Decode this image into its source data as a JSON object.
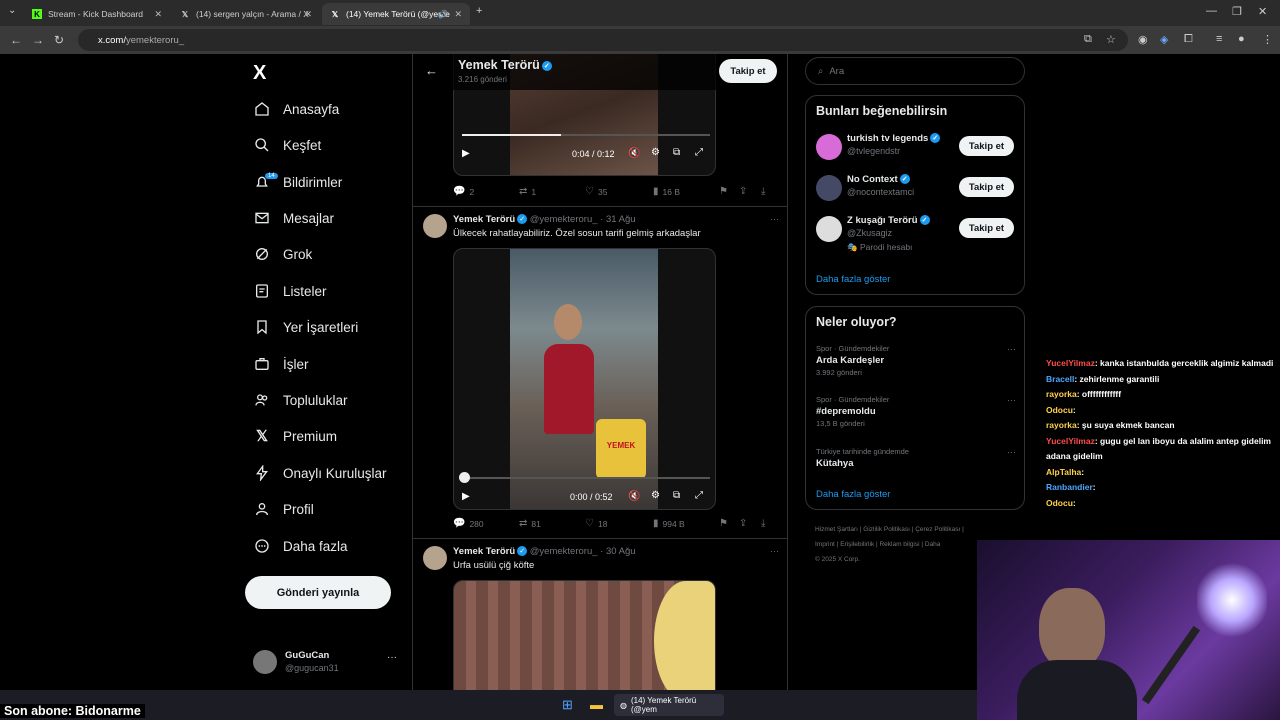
{
  "browser": {
    "tabs": [
      {
        "title": "Stream - Kick Dashboard",
        "icon": "kick-icon"
      },
      {
        "title": "(14) sergen yalçın - Arama / X",
        "icon": "x-icon"
      },
      {
        "title": "(14) Yemek Terörü (@yeme",
        "icon": "x-icon"
      }
    ],
    "url_host": "x.com/",
    "url_path": "yemekteroru_"
  },
  "nav": {
    "logo": "X",
    "badge": "14",
    "items": [
      "Anasayfa",
      "Keşfet",
      "Bildirimler",
      "Mesajlar",
      "Grok",
      "Listeler",
      "Yer İşaretleri",
      "İşler",
      "Topluluklar",
      "Premium",
      "Onaylı Kuruluşlar",
      "Profil",
      "Daha fazla"
    ],
    "post_button": "Gönderi yayınla",
    "account": {
      "name": "GuGuCan",
      "handle": "@gugucan31"
    }
  },
  "profile_header": {
    "name": "Yemek Terörü",
    "posts": "3.216 gönderi",
    "follow": "Takip et"
  },
  "tweets": [
    {
      "video_time": "0:04 / 0:12",
      "replies": "2",
      "reposts": "1",
      "likes": "35",
      "views": "16 B"
    },
    {
      "name": "Yemek Terörü",
      "handle": "@yemekteroru_",
      "date": "· 31 Ağu",
      "text": "Ülkecek rahatlayabiliriz. Özel sosun tarifi gelmiş arkadaşlar",
      "video_time": "0:00 / 0:52",
      "jar_label": "YEMEK",
      "replies": "280",
      "reposts": "81",
      "likes": "18",
      "views": "994 B"
    },
    {
      "name": "Yemek Terörü",
      "handle": "@yemekteroru_",
      "date": "· 30 Ağu",
      "text": "Urfa usülü çiğ köfte"
    }
  ],
  "right": {
    "search_placeholder": "Ara",
    "who_title": "Bunları beğenebilirsin",
    "who": [
      {
        "name": "turkish tv legends",
        "handle": "@tvlegendstr",
        "color": "#d86bd8"
      },
      {
        "name": "No Context",
        "handle": "@nocontextamci",
        "color": "#444a66"
      },
      {
        "name": "Z kuşağı Terörü",
        "handle": "@Zkusagiz",
        "sub": "Parodi hesabı",
        "color": "#dddddd"
      }
    ],
    "follow": "Takip et",
    "show_more": "Daha fazla göster",
    "trends_title": "Neler oluyor?",
    "trends": [
      {
        "cat": "Spor · Gündemdekiler",
        "title": "Arda Kardeşler",
        "count": "3.992 gönderi"
      },
      {
        "cat": "Spor · Gündemdekiler",
        "title": "#depremoldu",
        "count": "13,5 B gönderi"
      },
      {
        "cat": "Türkiye tarihinde gündemde",
        "title": "Kütahya",
        "count": ""
      }
    ],
    "footer": [
      "Hizmet Şartları",
      "Gizlilik Politikası",
      "Çerez Politikası",
      "Imprint",
      "Erişilebilirlik",
      "Reklam bilgisi",
      "Daha",
      "© 2025 X Corp."
    ]
  },
  "chat": [
    {
      "user": "YucelYilmaz",
      "color": "#ff4d4d",
      "msg": ": kanka istanbulda gerceklik algimiz kalmadi"
    },
    {
      "user": "Bracell",
      "color": "#4da6ff",
      "msg": ": zehirlenme garantili"
    },
    {
      "user": "rayorka",
      "color": "#ffd24d",
      "msg": ": offffffffffff"
    },
    {
      "user": "Odocu",
      "color": "#ffd24d",
      "msg": ": "
    },
    {
      "user": "rayorka",
      "color": "#ffd24d",
      "msg": ": şu suya ekmek bancan"
    },
    {
      "user": "YucelYilmaz",
      "color": "#ff4d4d",
      "msg": ": gugu gel lan iboyu da alalim antep gidelim adana gidelim"
    },
    {
      "user": "AlpTalha",
      "color": "#ffd24d",
      "msg": ": "
    },
    {
      "user": "Ranbandier",
      "color": "#4da6ff",
      "msg": ": "
    },
    {
      "user": "Odocu",
      "color": "#ffd24d",
      "msg": ": "
    }
  ],
  "stream": {
    "last_sub": "Son abone: Bidonarme",
    "taskbar_app": "(14) Yemek Terörü (@yem"
  }
}
